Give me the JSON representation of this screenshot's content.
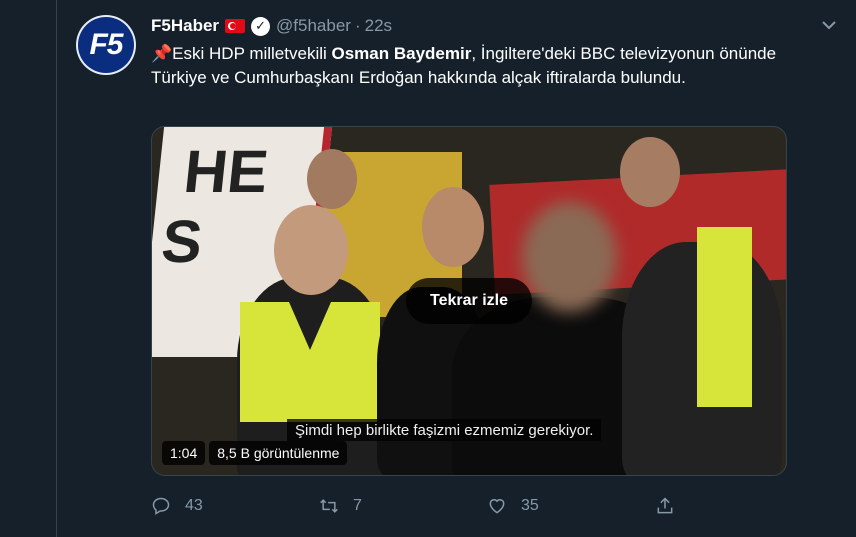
{
  "tweet": {
    "avatar_text": "F5",
    "display_name": "F5Haber",
    "handle": "@f5haber",
    "separator": "·",
    "time": "22s",
    "text_prefix": "Eski HDP milletvekili ",
    "text_bold": "Osman Baydemir",
    "text_suffix": ", İngiltere'deki BBC televizyonun önünde Türkiye ve Cumhurbaşkanı Erdoğan hakkında alçak iftiralarda bulundu."
  },
  "video": {
    "replay_label": "Tekrar izle",
    "subtitle": "Şimdi hep birlikte faşizmi ezmemiz gerekiyor.",
    "duration": "1:04",
    "views": "8,5 B görüntülenme"
  },
  "actions": {
    "reply_count": "43",
    "retweet_count": "7",
    "like_count": "35"
  },
  "colors": {
    "background": "#15202b",
    "secondary_text": "#8899a6",
    "border": "#38444d"
  },
  "icons": [
    "pin-icon",
    "turkey-flag-icon",
    "verified-icon",
    "chevron-down-icon",
    "reply-icon",
    "retweet-icon",
    "like-icon",
    "share-icon"
  ]
}
